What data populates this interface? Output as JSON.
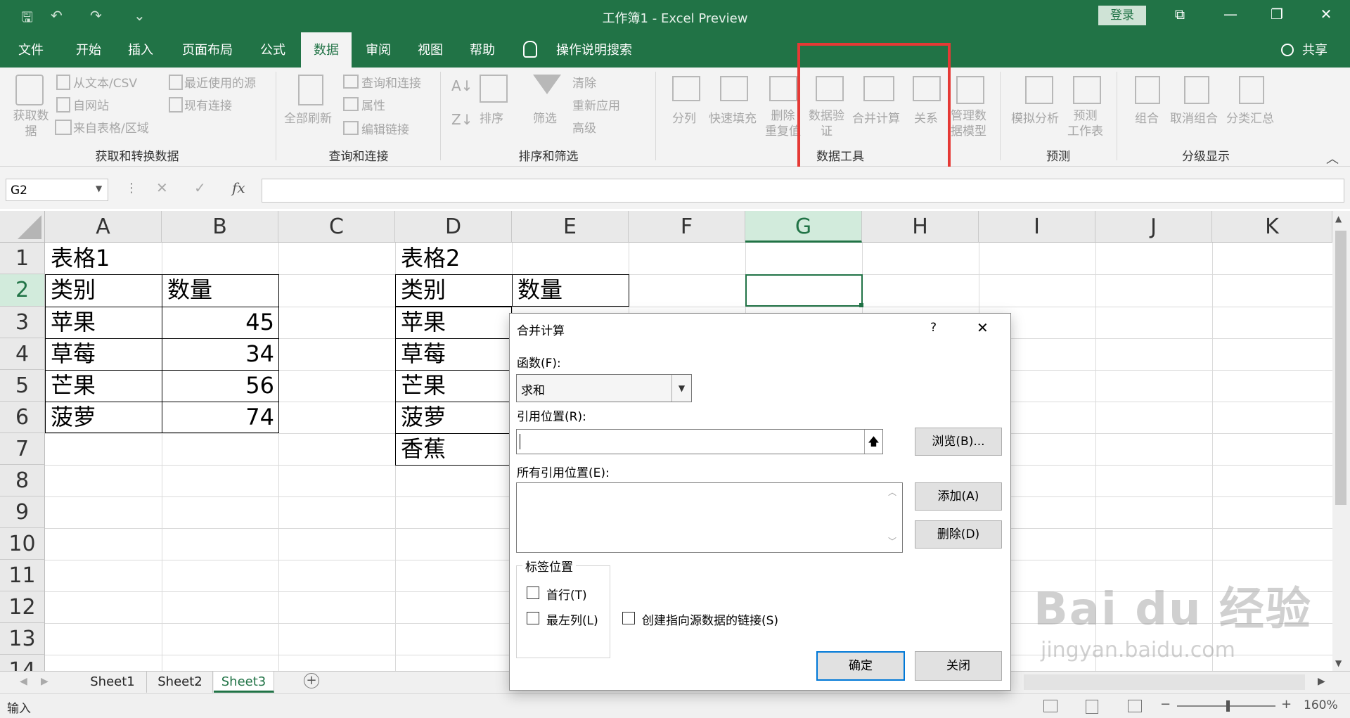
{
  "titlebar": {
    "title": "工作簿1  -  Excel Preview",
    "login": "登录",
    "qa": {
      "save": "🖫",
      "undo": "↶",
      "redo": "↷",
      "more": "⌄"
    },
    "win": {
      "ribbon_opts": "⧉",
      "min": "—",
      "max": "❐",
      "close": "✕"
    }
  },
  "tabs": [
    {
      "label": "文件"
    },
    {
      "label": "开始"
    },
    {
      "label": "插入"
    },
    {
      "label": "页面布局"
    },
    {
      "label": "公式"
    },
    {
      "label": "数据"
    },
    {
      "label": "审阅"
    },
    {
      "label": "视图"
    },
    {
      "label": "帮助"
    },
    {
      "label": "操作说明搜索"
    }
  ],
  "share": "共享",
  "ribbon": {
    "get_data": "获取数\n据",
    "from_text": "从文本/CSV",
    "from_web": "自网站",
    "from_table": "来自表格/区域",
    "recent_sources": "最近使用的源",
    "existing_conn": "现有连接",
    "group_get": "获取和转换数据",
    "refresh_all": "全部刷新",
    "queries": "查询和连接",
    "properties": "属性",
    "edit_links": "编辑链接",
    "group_query": "查询和连接",
    "sort": "排序",
    "filter": "筛选",
    "clear": "清除",
    "reapply": "重新应用",
    "advanced": "高级",
    "group_sort": "排序和筛选",
    "text_to_cols": "分列",
    "flash_fill": "快速填充",
    "remove_dup": "删除\n重复值",
    "data_validation": "数据验\n证",
    "consolidate": "合并计算",
    "relationships": "关系",
    "manage_model": "管理数\n据模型",
    "group_tools": "数据工具",
    "what_if": "模拟分析",
    "forecast_sheet": "预测\n工作表",
    "group_forecast": "预测",
    "group_btn": "组合",
    "ungroup": "取消组合",
    "subtotal": "分类汇总",
    "group_outline": "分级显示"
  },
  "formula_bar": {
    "name_box": "G2",
    "fx": "fx",
    "cancel": "✕",
    "enter": "✓",
    "value": ""
  },
  "columns": [
    "A",
    "B",
    "C",
    "D",
    "E",
    "F",
    "G",
    "H",
    "I",
    "J",
    "K"
  ],
  "rows": [
    "1",
    "2",
    "3",
    "4",
    "5",
    "6",
    "7",
    "8",
    "9",
    "10",
    "11",
    "12",
    "13",
    "14"
  ],
  "sheet": {
    "t1_title": "表格1",
    "t1_head": [
      "类别",
      "数量"
    ],
    "t1_rows": [
      [
        "苹果",
        "45"
      ],
      [
        "草莓",
        "34"
      ],
      [
        "芒果",
        "56"
      ],
      [
        "菠萝",
        "74"
      ]
    ],
    "t2_title": "表格2",
    "t2_head": [
      "类别",
      "数量"
    ],
    "t2_rows": [
      "苹果",
      "草莓",
      "芒果",
      "菠萝",
      "香蕉"
    ]
  },
  "sheets": [
    "Sheet1",
    "Sheet2",
    "Sheet3"
  ],
  "status": {
    "mode": "输入",
    "zoom": "160%"
  },
  "dialog": {
    "title": "合并计算",
    "help": "?",
    "close": "✕",
    "function_label": "函数(F):",
    "function_value": "求和",
    "ref_label": "引用位置(R):",
    "ref_value": "",
    "browse": "浏览(B)...",
    "all_refs_label": "所有引用位置(E):",
    "add": "添加(A)",
    "delete": "删除(D)",
    "labels_group": "标签位置",
    "top_row": "首行(T)",
    "left_col": "最左列(L)",
    "create_links": "创建指向源数据的链接(S)",
    "ok": "确定",
    "cancel": "关闭"
  },
  "watermark": {
    "brand": "Bai du 经验",
    "url": "jingyan.baidu.com"
  },
  "colors": {
    "excel_green": "#217346",
    "highlight": "#e53935"
  }
}
